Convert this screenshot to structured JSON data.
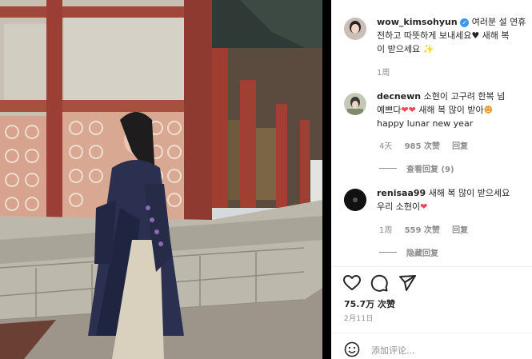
{
  "post": {
    "author": {
      "username": "wow_kimsohyun",
      "verified_icon": "verified-badge-icon",
      "caption_line1": "여러분 설 연휴",
      "caption_line2": "잘 보내세요",
      "caption_line3": "전하고 따뜻하게 보내세요♥ 새해 복",
      "caption_line4": "이 받으세요",
      "caption_emoji": "✨",
      "time": "1周"
    },
    "caption_display": {
      "line1_rest": "여러분 설 연휴",
      "line2": "전하고 따뜻하게 보내세요",
      "line2_tail": " 새해 복",
      "line3": "이 받으세요"
    },
    "likes": "75.7万 次赞",
    "date": "2月11日",
    "add_comment_placeholder": "添加评论..."
  },
  "comments": [
    {
      "username": "decnewn",
      "line1": "소현이 고구려 한복 넘",
      "line2_a": "예쁘다",
      "line2_b": "새해 복 많이 받아",
      "line3": "happy lunar new year",
      "time": "4天",
      "likes": "985 次赞",
      "reply": "回复",
      "view_replies": "查看回复 (9)"
    },
    {
      "username": "renisaa99",
      "line1": "새해 복 많이 받으세요",
      "line2": "우리 소현이",
      "time": "1周",
      "likes": "559 次赞",
      "reply": "回复",
      "hide_replies": "隐藏回复"
    }
  ],
  "colors": {
    "heart_red": "#ed4956",
    "verified_blue": "#3897f0",
    "muted_gray": "#8e8e8e",
    "text_dark": "#262626"
  },
  "icons": [
    "like-heart-icon",
    "comment-icon",
    "share-icon",
    "emoji-icon"
  ]
}
